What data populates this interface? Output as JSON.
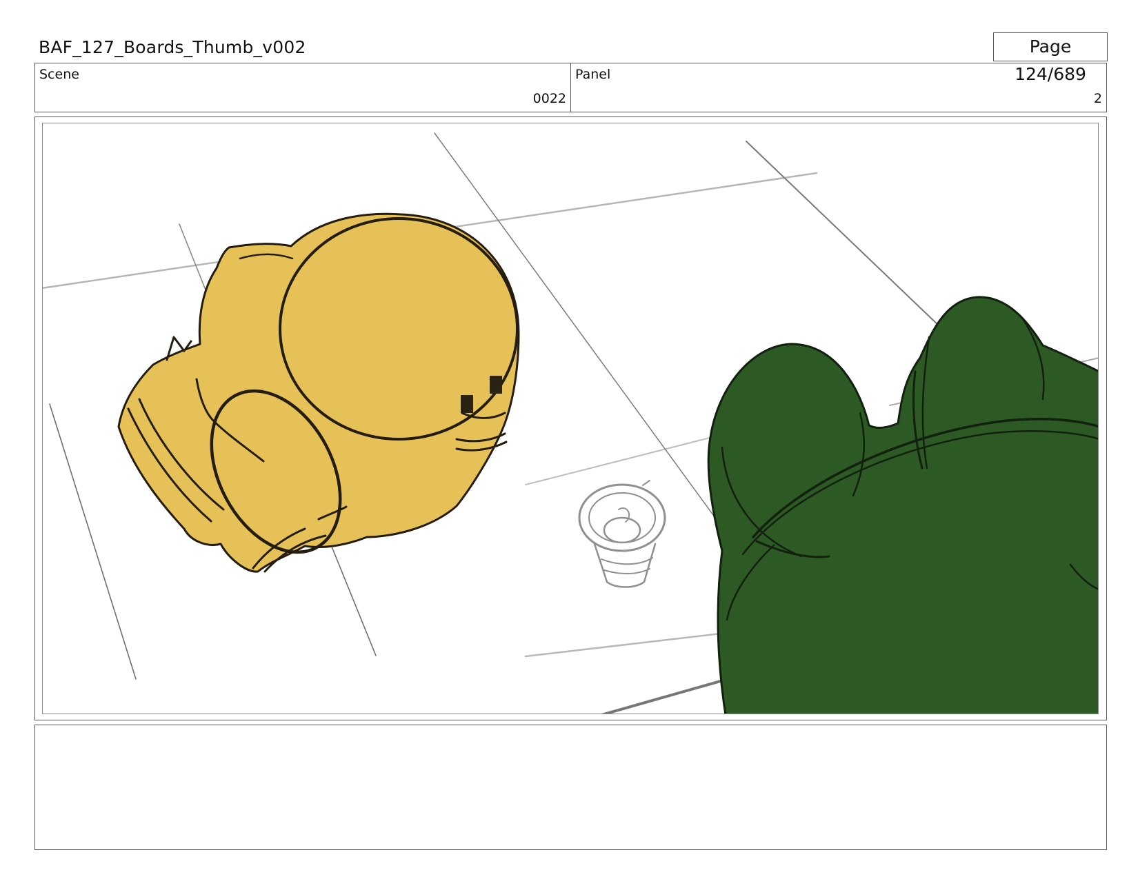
{
  "header": {
    "title": "BAF_127_Boards_Thumb_v002",
    "page": "Page 124/689"
  },
  "info": {
    "scene_label": "Scene",
    "scene_value": "0022",
    "panel_label": "Panel",
    "panel_value": "2"
  },
  "colors": {
    "yellow_character": "#e5c157",
    "green_character": "#2d5925",
    "sketch_line": "#9a9a9a",
    "ink": "#1e1a10"
  },
  "notes": {
    "text": ""
  }
}
